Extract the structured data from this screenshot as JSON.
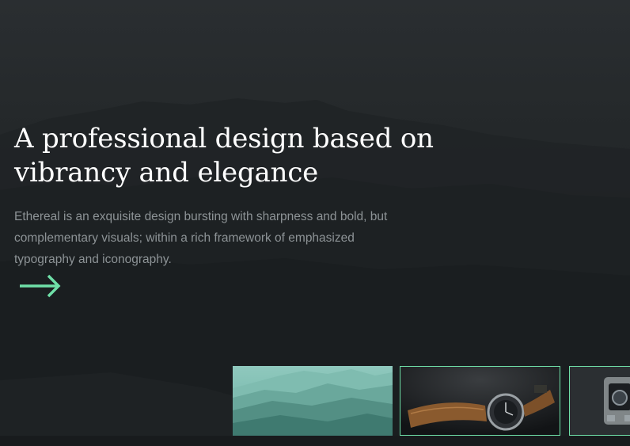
{
  "hero": {
    "title_line1": "A professional design based on",
    "title_line2": "vibrancy and elegance",
    "body": "Ethereal is an exquisite design bursting with sharpness and bold, but complementary visuals; within a rich framework of emphasized typography and iconography."
  },
  "colors": {
    "background": "#1c1f21",
    "accent": "#6fe0a8",
    "title": "#ffffff",
    "body_text": "#8d9396"
  },
  "icons": {
    "next": "right-arrow-icon"
  },
  "gallery": {
    "items": [
      {
        "subject": "teal mountain ridges"
      },
      {
        "subject": "wristwatch with brown leather strap"
      },
      {
        "subject": "camera in underwater housing"
      }
    ]
  }
}
